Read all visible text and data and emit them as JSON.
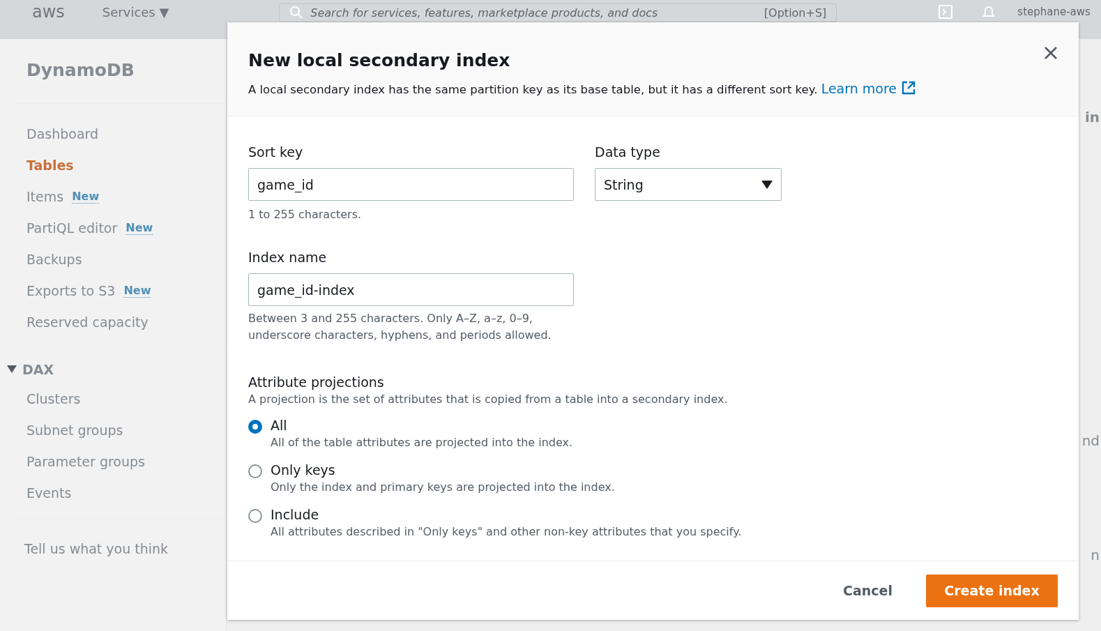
{
  "top_bar": {
    "logo": "aws",
    "services": "Services ▼",
    "search": {
      "placeholder": "Search for services, features, marketplace products, and docs",
      "shortcut": "[Option+S]"
    },
    "account": "stephane-aws"
  },
  "sidebar": {
    "title": "DynamoDB",
    "items": [
      {
        "label": "Dashboard",
        "selected": false
      },
      {
        "label": "Tables",
        "selected": true
      },
      {
        "label": "Items",
        "badge": "New",
        "selected": false
      },
      {
        "label": "PartiQL editor",
        "badge": "New",
        "selected": false
      },
      {
        "label": "Backups",
        "selected": false
      },
      {
        "label": "Exports to S3",
        "badge": "New",
        "selected": false
      },
      {
        "label": "Reserved capacity",
        "selected": false
      }
    ],
    "section": {
      "label": "DAX",
      "expanded": true,
      "items": [
        {
          "label": "Clusters",
          "selected": false
        },
        {
          "label": "Subnet groups",
          "selected": false
        },
        {
          "label": "Parameter groups",
          "selected": false
        },
        {
          "label": "Events",
          "selected": false
        }
      ]
    },
    "feedback": "Tell us what you think"
  },
  "background_fragments": [
    "in",
    "nd",
    "n"
  ],
  "dialog": {
    "title": "New local secondary index",
    "description": "A local secondary index has the same partition key as its base table, but it has a different sort key.",
    "learn_more": "Learn more",
    "sort_key": {
      "label": "Sort key",
      "value": "game_id",
      "hint": "1 to 255 characters."
    },
    "data_type": {
      "label": "Data type",
      "value": "String"
    },
    "index_name": {
      "label": "Index name",
      "value": "game_id-index",
      "hint": "Between 3 and 255 characters. Only A–Z, a–z, 0–9, underscore characters, hyphens, and periods allowed."
    },
    "projections": {
      "label": "Attribute projections",
      "description": "A projection is the set of attributes that is copied from a table into a secondary index.",
      "options": [
        {
          "label": "All",
          "description": "All of the table attributes are projected into the index.",
          "selected": true
        },
        {
          "label": "Only keys",
          "description": "Only the index and primary keys are projected into the index.",
          "selected": false
        },
        {
          "label": "Include",
          "description": "All attributes described in \"Only keys\" and other non-key attributes that you specify.",
          "selected": false
        }
      ]
    },
    "buttons": {
      "cancel": "Cancel",
      "create": "Create index"
    }
  }
}
